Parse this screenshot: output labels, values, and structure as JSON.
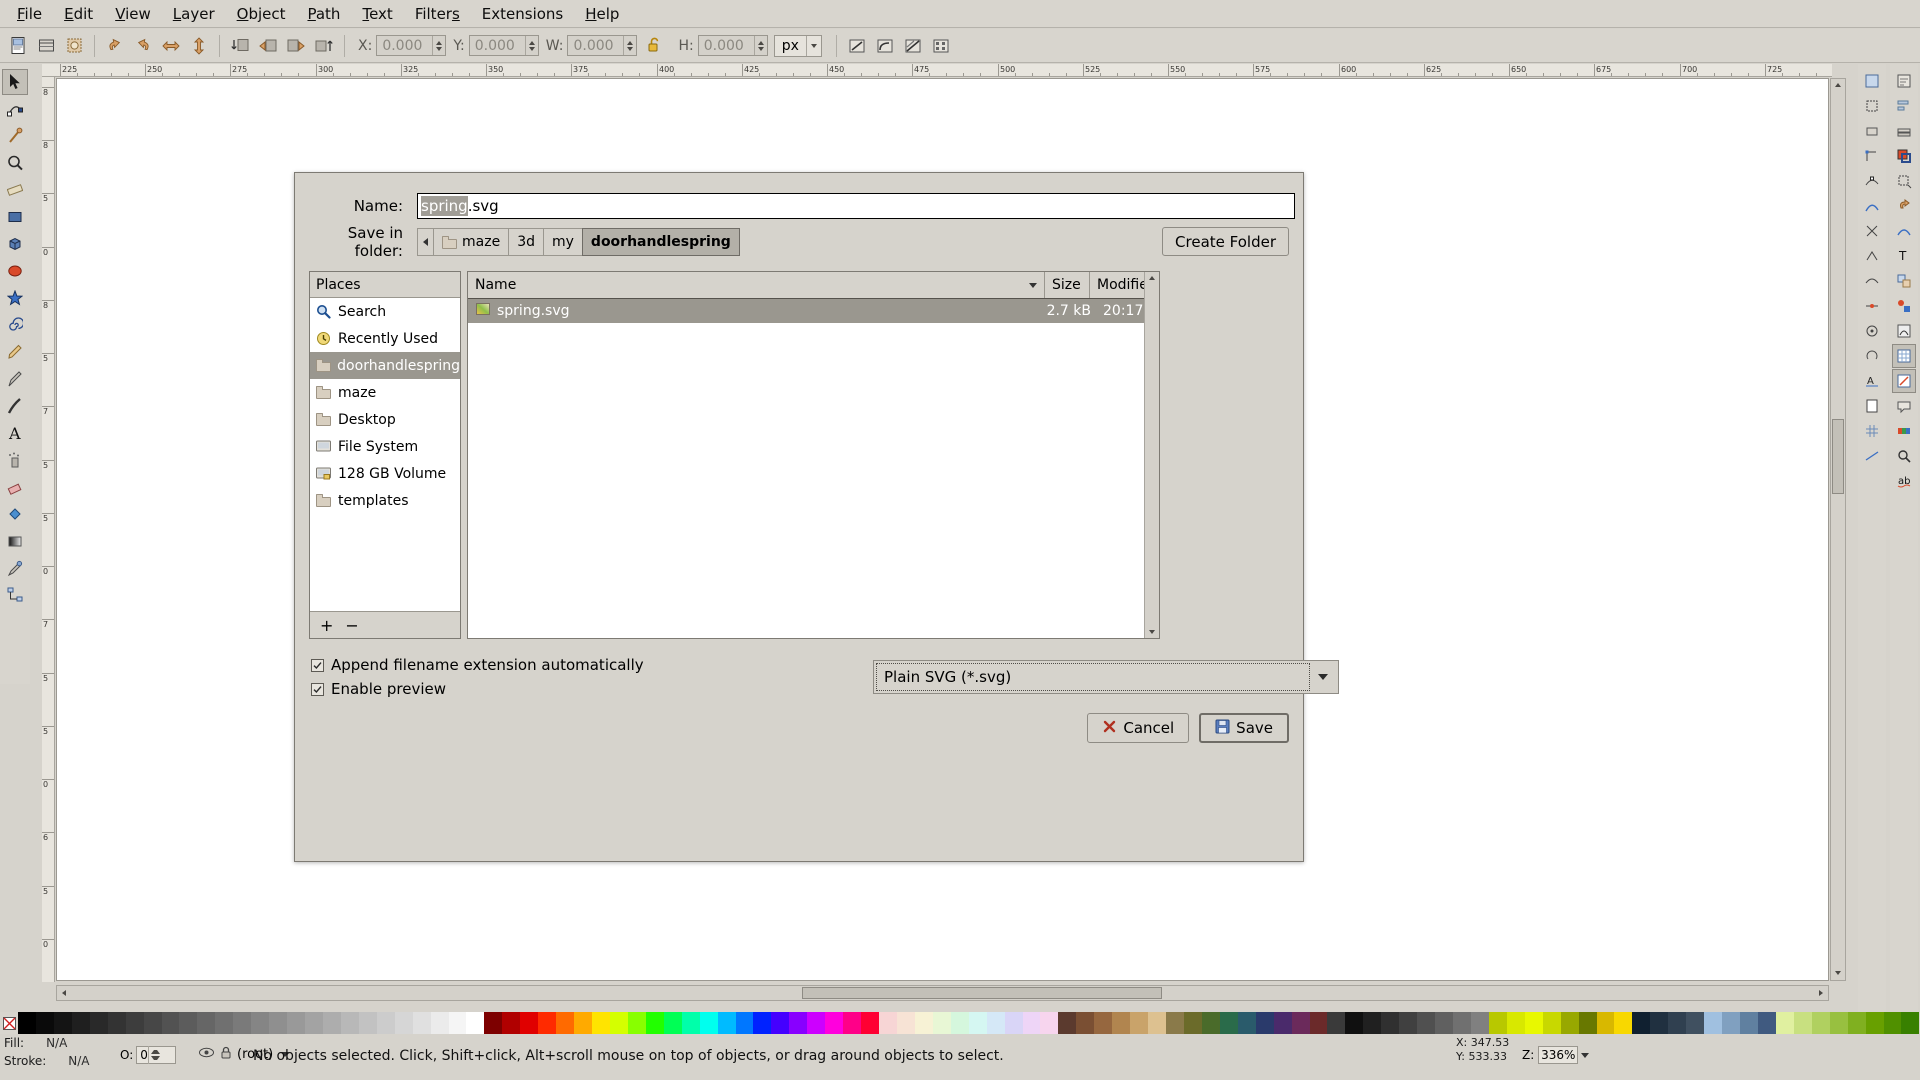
{
  "menu": {
    "items": [
      {
        "label": "File",
        "mnemonic": "F"
      },
      {
        "label": "Edit",
        "mnemonic": "E"
      },
      {
        "label": "View",
        "mnemonic": "V"
      },
      {
        "label": "Layer",
        "mnemonic": "L"
      },
      {
        "label": "Object",
        "mnemonic": "O"
      },
      {
        "label": "Path",
        "mnemonic": "P"
      },
      {
        "label": "Text",
        "mnemonic": "T"
      },
      {
        "label": "Filters",
        "mnemonic": "s"
      },
      {
        "label": "Extensions",
        "mnemonic": "N"
      },
      {
        "label": "Help",
        "mnemonic": "H"
      }
    ]
  },
  "toolbar": {
    "icons_left": [
      "select-all-icon",
      "select-all-layers-icon",
      "deselect-icon"
    ],
    "icons_rotate": [
      "rotate-ccw-icon",
      "rotate-cw-icon",
      "flip-horizontal-icon",
      "flip-vertical-icon"
    ],
    "icons_raise": [
      "lower-to-bottom-icon",
      "lower-icon",
      "raise-icon",
      "raise-to-top-icon"
    ],
    "x_label": "X:",
    "x_value": "0.000",
    "y_label": "Y:",
    "y_value": "0.000",
    "w_label": "W:",
    "w_value": "0.000",
    "h_label": "H:",
    "h_value": "0.000",
    "lock_icon": "lock-open-icon",
    "unit_value": "px",
    "affect_icons": [
      "affect-stroke-icon",
      "affect-corners-icon",
      "affect-gradients-icon",
      "affect-patterns-icon"
    ]
  },
  "dialog": {
    "name_label": "Name:",
    "name_selected": "spring",
    "name_rest": ".svg",
    "folder_label": "Save in folder:",
    "breadcrumbs": [
      {
        "label": "",
        "icon": "left-arrow-icon",
        "active": false,
        "home": false
      },
      {
        "label": "maze",
        "icon": "home-folder-icon",
        "active": false,
        "home": true
      },
      {
        "label": "3d",
        "icon": "",
        "active": false,
        "home": false
      },
      {
        "label": "my",
        "icon": "",
        "active": false,
        "home": false
      },
      {
        "label": "doorhandlespring",
        "icon": "",
        "active": true,
        "home": false
      }
    ],
    "create_folder_label": "Create Folder",
    "places_header": "Places",
    "places": [
      {
        "label": "Search",
        "icon": "search-icon",
        "selected": false
      },
      {
        "label": "Recently Used",
        "icon": "recent-clock-icon",
        "selected": false
      },
      {
        "label": "doorhandlespring",
        "icon": "folder-icon",
        "selected": true
      },
      {
        "label": "maze",
        "icon": "home-folder-icon",
        "selected": false
      },
      {
        "label": "Desktop",
        "icon": "desktop-folder-icon",
        "selected": false
      },
      {
        "label": "File System",
        "icon": "drive-icon",
        "selected": false
      },
      {
        "label": "128 GB Volume",
        "icon": "volume-icon",
        "selected": false
      },
      {
        "label": "templates",
        "icon": "folder-icon",
        "selected": false
      }
    ],
    "places_add": "+",
    "places_remove": "−",
    "columns": [
      "Name",
      "Size",
      "Modified"
    ],
    "files": [
      {
        "name": "spring.svg",
        "size": "2.7 kB",
        "modified": "20:17",
        "icon": "svg-file-icon",
        "selected": true
      }
    ],
    "checkboxes": [
      {
        "label": "Append filename extension automatically",
        "checked": true
      },
      {
        "label": "Enable preview",
        "checked": true
      }
    ],
    "filetype_value": "Plain SVG (*.svg)",
    "cancel_label": "Cancel",
    "save_label": "Save"
  },
  "statusbar": {
    "fill_label": "Fill:",
    "fill_value": "N/A",
    "stroke_label": "Stroke:",
    "stroke_value": "N/A",
    "opacity_label": "O:",
    "opacity_value": "0",
    "layer_name": "(root)",
    "message": "No objects selected. Click, Shift+click, Alt+scroll mouse on top of objects, or drag around objects to select.",
    "x_label": "X:",
    "x_value": "347.53",
    "y_label": "Y:",
    "y_value": "533.33",
    "zoom_label": "Z:",
    "zoom_value": "336%"
  },
  "rulers": {
    "h_ticks": [
      "225",
      "250",
      "275",
      "300",
      "325",
      "350",
      "375",
      "400",
      "425",
      "450",
      "475",
      "500",
      "525",
      "550",
      "575",
      "600",
      "625",
      "650",
      "675",
      "700",
      "725"
    ],
    "v_ticks": [
      "8",
      "8",
      "5",
      "0",
      "8",
      "5",
      "7",
      "5",
      "5",
      "0",
      "7",
      "5",
      "5",
      "0",
      "6",
      "5",
      "0"
    ]
  },
  "colors": {
    "window_bg": "#d6d3cc",
    "selection_gray": "#9a978f",
    "canvas_white": "#ffffff",
    "border_dark": "#7d7a73"
  }
}
